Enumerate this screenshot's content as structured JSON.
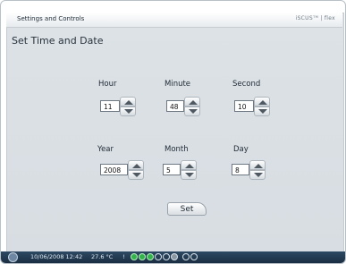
{
  "window": {
    "title": "Settings and Controls",
    "brand": "iSCUSᵀᴹ | flex"
  },
  "page": {
    "heading": "Set Time and Date"
  },
  "time": {
    "hour_label": "Hour",
    "hour_value": "11",
    "minute_label": "Minute",
    "minute_value": "48",
    "second_label": "Second",
    "second_value": "10"
  },
  "date": {
    "year_label": "Year",
    "year_value": "2008",
    "month_label": "Month",
    "month_value": "5",
    "day_label": "Day",
    "day_value": "8"
  },
  "actions": {
    "set_label": "Set"
  },
  "statusbar": {
    "datetime": "10/06/2008 12:42",
    "temperature": "27.6 °C",
    "separator": "!"
  }
}
